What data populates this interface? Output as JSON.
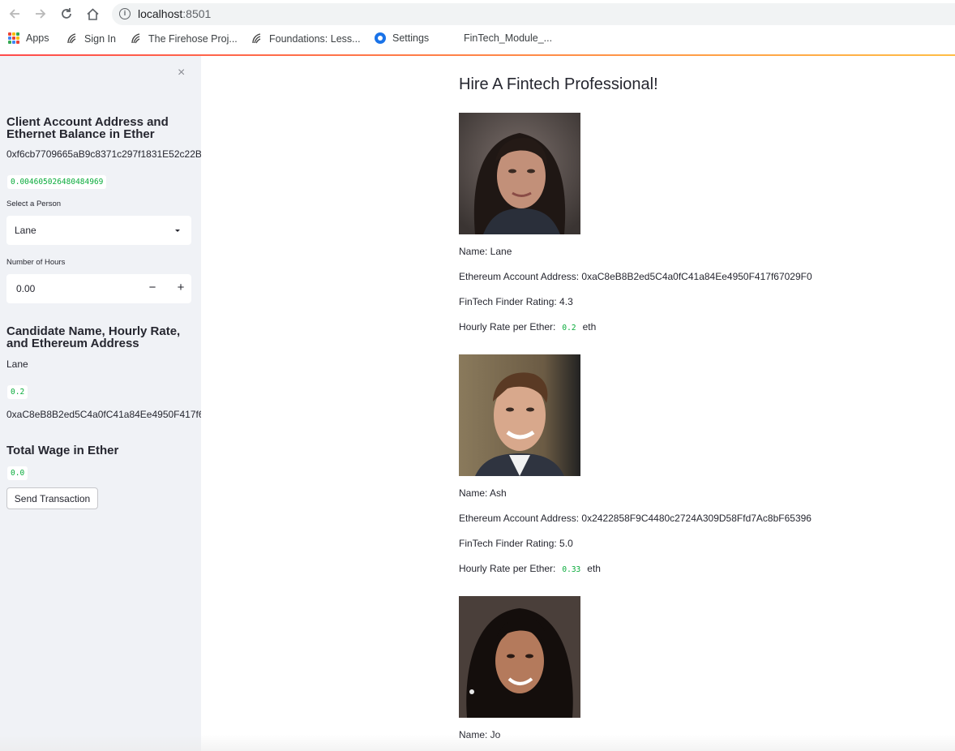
{
  "browser": {
    "url_host": "localhost",
    "url_port": ":8501",
    "bookmarks": [
      {
        "label": "Apps",
        "icon": "apps-grid-icon"
      },
      {
        "label": "Sign In",
        "icon": "firehose-icon"
      },
      {
        "label": "The Firehose Proj...",
        "icon": "firehose-icon"
      },
      {
        "label": "Foundations: Less...",
        "icon": "firehose-icon"
      },
      {
        "label": "Settings",
        "icon": "gear-icon"
      },
      {
        "label": "FinTech_Module_...",
        "icon": ""
      }
    ]
  },
  "sidebar": {
    "close_icon": "×",
    "account_header": "Client Account Address and Ethernet Balance in Ether",
    "account_address": "0xf6cb7709665aB9c8371c297f1831E52c22B",
    "balance": "0.004605026480484969",
    "select_label": "Select a Person",
    "select_value": "Lane",
    "hours_label": "Number of Hours",
    "hours_value": "0.00",
    "minus": "−",
    "plus": "+",
    "candidate_header": "Candidate Name, Hourly Rate, and Ethereum Address",
    "candidate_name": "Lane",
    "candidate_rate": "0.2",
    "candidate_address": "0xaC8eB8B2ed5C4a0fC41a84Ee4950F417f6",
    "wage_header": "Total Wage in Ether",
    "wage_value": "0.0",
    "send_button": "Send Transaction"
  },
  "main": {
    "title": "Hire A Fintech Professional!",
    "rate_label": "Hourly Rate per Ether:",
    "rate_unit": "eth",
    "candidates": [
      {
        "name": "Name: Lane",
        "address": "Ethereum Account Address: 0xaC8eB8B2ed5C4a0fC41a84Ee4950F417f67029F0",
        "rating": "FinTech Finder Rating: 4.3",
        "rate": "0.2"
      },
      {
        "name": "Name: Ash",
        "address": "Ethereum Account Address: 0x2422858F9C4480c2724A309D58Ffd7Ac8bF65396",
        "rating": "FinTech Finder Rating: 5.0",
        "rate": "0.33"
      },
      {
        "name": "Name: Jo"
      }
    ]
  },
  "colors": {
    "accent_gradient_start": "#ff4b4b",
    "accent_gradient_end": "#ffbd45",
    "code_green": "#09ab3b",
    "sidebar_bg": "#f0f2f6"
  }
}
